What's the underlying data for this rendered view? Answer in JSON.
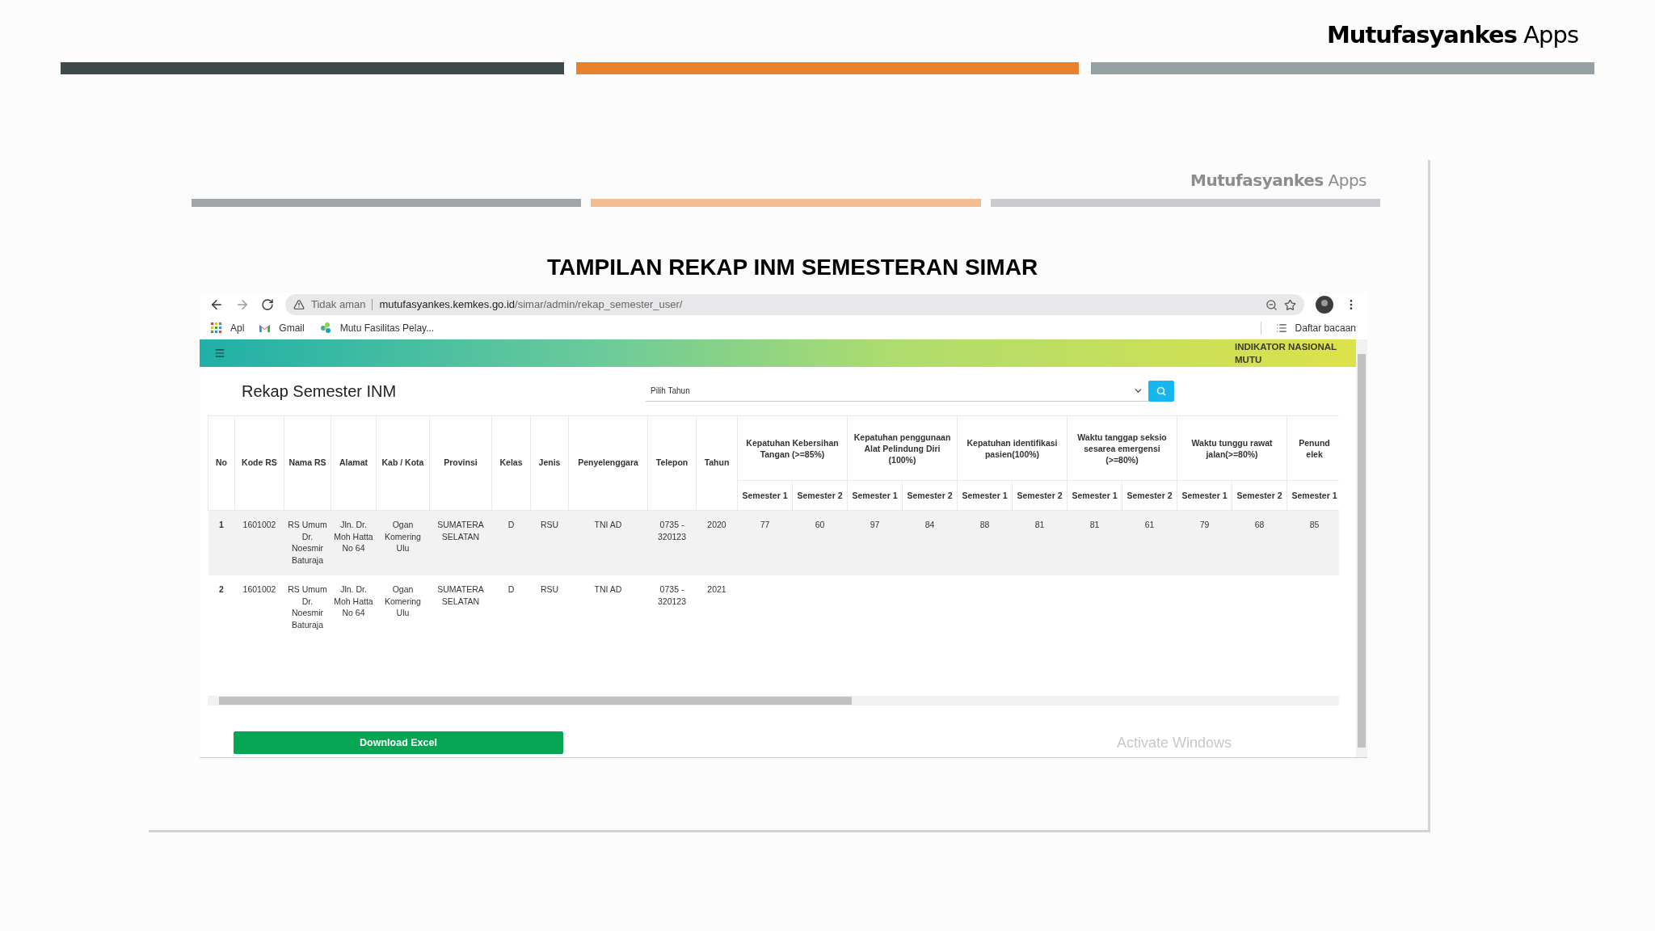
{
  "slide": {
    "brand_bold": "Mutufasyankes",
    "brand_light": "Apps"
  },
  "inner_slide": {
    "brand_bold": "Mutufasyankes",
    "brand_light": "Apps",
    "title": "TAMPILAN REKAP INM SEMESTERAN SIMAR"
  },
  "browser": {
    "security": "Tidak aman",
    "url_host": "mutufasyankes.kemkes.go.id",
    "url_path": "/simar/admin/rekap_semester_user/",
    "bookmarks": [
      {
        "kind": "apps",
        "label": "Apl"
      },
      {
        "kind": "gmail",
        "label": "Gmail"
      },
      {
        "kind": "site",
        "label": "Mutu Fasilitas Pelay..."
      }
    ],
    "reading_list": "Daftar bacaan"
  },
  "page": {
    "header_title": "INDIKATOR NASIONAL MUTU",
    "heading": "Rekap Semester INM",
    "year_select": {
      "placeholder": "Pilih Tahun"
    },
    "table": {
      "columns": [
        "No",
        "Kode RS",
        "Nama RS",
        "Alamat",
        "Kab / Kota",
        "Provinsi",
        "Kelas",
        "Jenis",
        "Penyelenggara",
        "Telepon",
        "Tahun"
      ],
      "indicator_groups": [
        {
          "title": "Kepatuhan Kebersihan Tangan (>=85%)",
          "semesters": [
            "Semester 1",
            "Semester 2"
          ]
        },
        {
          "title": "Kepatuhan penggunaan Alat Pelindung Diri (100%)",
          "semesters": [
            "Semester 1",
            "Semester 2"
          ]
        },
        {
          "title": "Kepatuhan identifikasi pasien(100%)",
          "semesters": [
            "Semester 1",
            "Semester 2"
          ]
        },
        {
          "title": "Waktu tanggap seksio sesarea emergensi (>=80%)",
          "semesters": [
            "Semester 1",
            "Semester 2"
          ]
        },
        {
          "title": "Waktu tunggu rawat jalan(>=80%)",
          "semesters": [
            "Semester 1",
            "Semester 2"
          ]
        },
        {
          "title": "Penund elek",
          "semesters": [
            "Semester 1"
          ]
        }
      ],
      "rows": [
        {
          "cells": [
            "1",
            "1601002",
            "RS Umum Dr. Noesmir Baturaja",
            "Jln. Dr. Moh Hatta No 64",
            "Ogan Komering Ulu",
            "SUMATERA SELATAN",
            "D",
            "RSU",
            "TNI AD",
            "0735 - 320123",
            "2020"
          ],
          "scores": [
            "77",
            "60",
            "97",
            "84",
            "88",
            "81",
            "81",
            "61",
            "79",
            "68",
            "85"
          ]
        },
        {
          "cells": [
            "2",
            "1601002",
            "RS Umum Dr. Noesmir Baturaja",
            "Jln. Dr. Moh Hatta No 64",
            "Ogan Komering Ulu",
            "SUMATERA SELATAN",
            "D",
            "RSU",
            "TNI AD",
            "0735 - 320123",
            "2021"
          ]
        }
      ]
    },
    "download_button": "Download Excel"
  },
  "os_notice": "Activate Windows"
}
